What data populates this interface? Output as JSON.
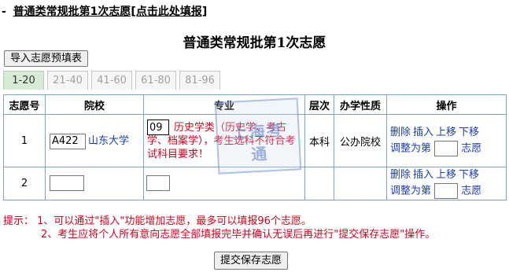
{
  "header": {
    "bullet": "-",
    "link_text": "普通类常规批第1次志愿[点击此处填报]"
  },
  "page_title": "普通类常规批第1次志愿",
  "import_button": "导入志愿预填表",
  "tabs": [
    "1-20",
    "21-40",
    "41-60",
    "61-80",
    "81-96"
  ],
  "table": {
    "headers": {
      "index": "志愿号",
      "school": "院校",
      "major": "专业",
      "level": "层次",
      "nature": "办学性质",
      "ops": "操作"
    },
    "rows": [
      {
        "index": "1",
        "school_code": "A422",
        "school_name": "山东大学",
        "major_code": "09",
        "major_text": "历史学类（历史学、考古学、档案学），考生选科不符合考试科目要求！",
        "level": "本科",
        "nature": "公办院校",
        "ops": {
          "delete": "删除",
          "insert": "插入",
          "up": "上移",
          "down": "下移",
          "adjust_prefix": "调整为第",
          "adjust_suffix": "志愿",
          "seq_value": ""
        }
      },
      {
        "index": "2",
        "school_code": "",
        "major_code": "",
        "ops": {
          "delete": "删除",
          "insert": "插入",
          "up": "上移",
          "down": "下移",
          "adjust_prefix": "调整为第",
          "adjust_suffix": "志愿",
          "seq_value": ""
        }
      }
    ]
  },
  "watermark": {
    "line1": "上海考",
    "line2": "通"
  },
  "hints": {
    "line1": "提示：  1、可以通过\"插入\"功能增加志愿，最多可以填报96个志愿。",
    "line2": "2、考生应将个人所有意向志愿全部填报完毕并确认无误后再进行\"提交保存志愿\"操作。"
  },
  "submit_button": "提交保存志愿",
  "colors": {
    "link_blue": "#1b3db8",
    "warning_red": "#d9001b",
    "table_border": "#7fa3c8",
    "active_tab": "#d6ebd6"
  }
}
